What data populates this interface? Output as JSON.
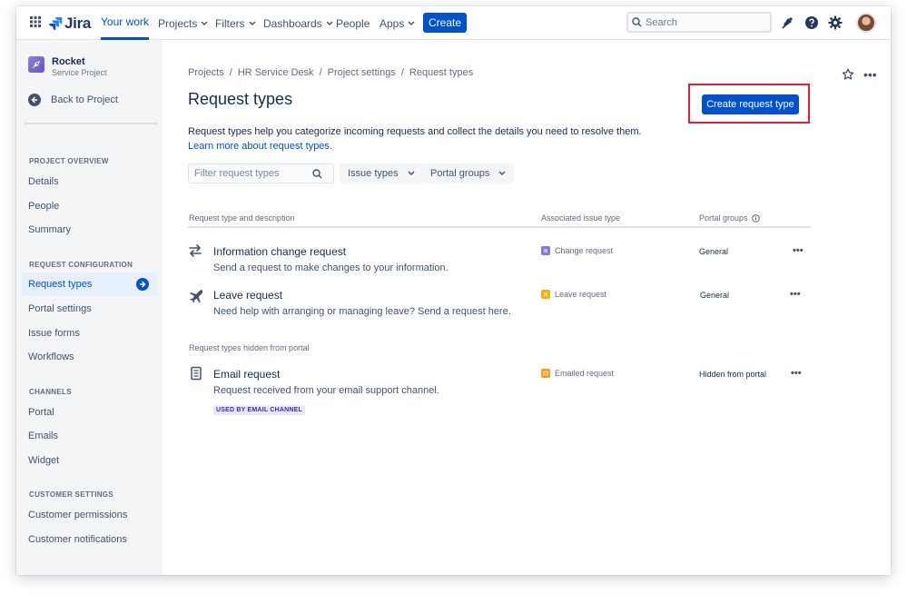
{
  "topnav": {
    "logo_text": "Jira",
    "items": [
      {
        "label": "Your work"
      },
      {
        "label": "Projects"
      },
      {
        "label": "Filters"
      },
      {
        "label": "Dashboards"
      },
      {
        "label": "People"
      },
      {
        "label": "Apps"
      }
    ],
    "create_label": "Create",
    "search_placeholder": "Search"
  },
  "sidebar": {
    "project_name": "Rocket",
    "project_type": "Service Project",
    "back_label": "Back to Project",
    "sections": [
      {
        "title": "PROJECT OVERVIEW",
        "items": [
          "Details",
          "People",
          "Summary"
        ]
      },
      {
        "title": "REQUEST CONFIGURATION",
        "items": [
          "Request types",
          "Portal settings",
          "Issue forms",
          "Workflows"
        ]
      },
      {
        "title": "CHANNELS",
        "items": [
          "Portal",
          "Emails",
          "Widget"
        ]
      },
      {
        "title": "CUSTOMER SETTINGS",
        "items": [
          "Customer permissions",
          "Customer notifications"
        ]
      }
    ]
  },
  "main": {
    "breadcrumb": [
      "Projects",
      "/",
      "HR Service Desk",
      "/",
      "Project settings",
      "/",
      "Request types"
    ],
    "title": "Request types",
    "create_button": "Create request type",
    "description": "Request types help you categorize incoming requests and collect the details you need to resolve them.",
    "learn_more": "Learn more about request types.",
    "filter_placeholder": "Filter request types",
    "issue_types_label": "Issue types",
    "portal_groups_label": "Portal groups",
    "columns": {
      "c1": "Request type and description",
      "c2": "Associated issue type",
      "c3": "Portal groups"
    },
    "rows": [
      {
        "title": "Information change request",
        "desc": "Send a request to make changes to your information.",
        "issue": "Change request",
        "portal": "General"
      },
      {
        "title": "Leave request",
        "desc": "Need help with arranging or managing leave? Send a request here.",
        "issue": "Leave request",
        "portal": "General"
      }
    ],
    "hidden_heading": "Request types hidden from portal",
    "hidden_rows": [
      {
        "title": "Email request",
        "desc": "Request received from your email support channel.",
        "issue": "Emailed request",
        "portal": "Hidden from portal",
        "lozenge": "USED BY EMAIL CHANNEL"
      }
    ]
  },
  "colors": {
    "brand": "#0052cc",
    "highlight": "#e3202a",
    "change_issue": "#8777d9",
    "leave_issue": "#ffab00",
    "email_issue": "#ff991f"
  }
}
